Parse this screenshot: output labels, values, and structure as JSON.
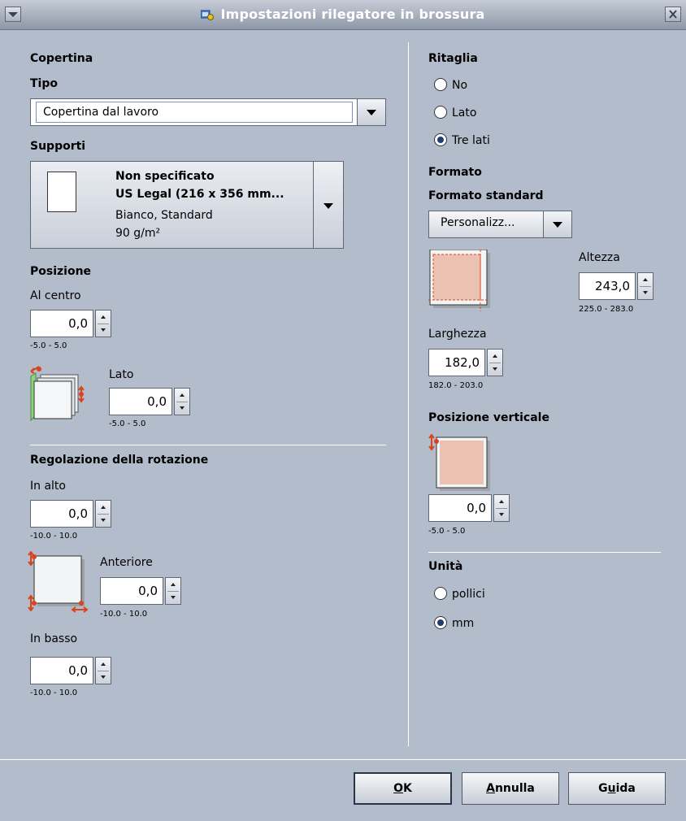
{
  "window": {
    "title": "Impostazioni rilegatore in brossura",
    "icon": "settings-app-icon",
    "menu_icon": "window-menu-icon",
    "close_icon": "close-icon"
  },
  "left": {
    "copertina_header": "Copertina",
    "tipo_label": "Tipo",
    "tipo_value": "Copertina dal lavoro",
    "supporti_label": "Supporti",
    "supporti": {
      "line1": "Non specificato",
      "line2": "US Legal (216 x 356 mm...",
      "line3": "Bianco, Standard",
      "line4": "90 g/m²"
    },
    "posizione_header": "Posizione",
    "al_centro_label": "Al centro",
    "al_centro_value": "0,0",
    "al_centro_range": "-5.0 - 5.0",
    "lato_label": "Lato",
    "lato_value": "0,0",
    "lato_range": "-5.0 - 5.0",
    "rotazione_header": "Regolazione della rotazione",
    "in_alto_label": "In alto",
    "in_alto_value": "0,0",
    "in_alto_range": "-10.0 - 10.0",
    "anteriore_label": "Anteriore",
    "anteriore_value": "0,0",
    "anteriore_range": "-10.0 - 10.0",
    "in_basso_label": "In basso",
    "in_basso_value": "0,0",
    "in_basso_range": "-10.0 - 10.0"
  },
  "right": {
    "ritaglia_header": "Ritaglia",
    "ritaglia_options": [
      "No",
      "Lato",
      "Tre lati"
    ],
    "ritaglia_selected": "Tre lati",
    "formato_header": "Formato",
    "formato_standard_label": "Formato standard",
    "formato_standard_value": "Personalizz...",
    "altezza_label": "Altezza",
    "altezza_value": "243,0",
    "altezza_range": "225.0 - 283.0",
    "larghezza_label": "Larghezza",
    "larghezza_value": "182,0",
    "larghezza_range": "182.0 - 203.0",
    "posizione_verticale_header": "Posizione verticale",
    "posizione_verticale_value": "0,0",
    "posizione_verticale_range": "-5.0 - 5.0",
    "unita_header": "Unità",
    "unita_options": [
      "pollici",
      "mm"
    ],
    "unita_selected": "mm"
  },
  "buttons": {
    "ok_mnemonic": "O",
    "ok_rest": "K",
    "annulla_mnemonic": "A",
    "annulla_rest": "nnulla",
    "guida_pre": "G",
    "guida_mnemonic": "u",
    "guida_rest": "ida"
  },
  "colors": {
    "background": "#b3bccb",
    "selected_radio": "#223b73",
    "accent_red": "#d9441c"
  }
}
